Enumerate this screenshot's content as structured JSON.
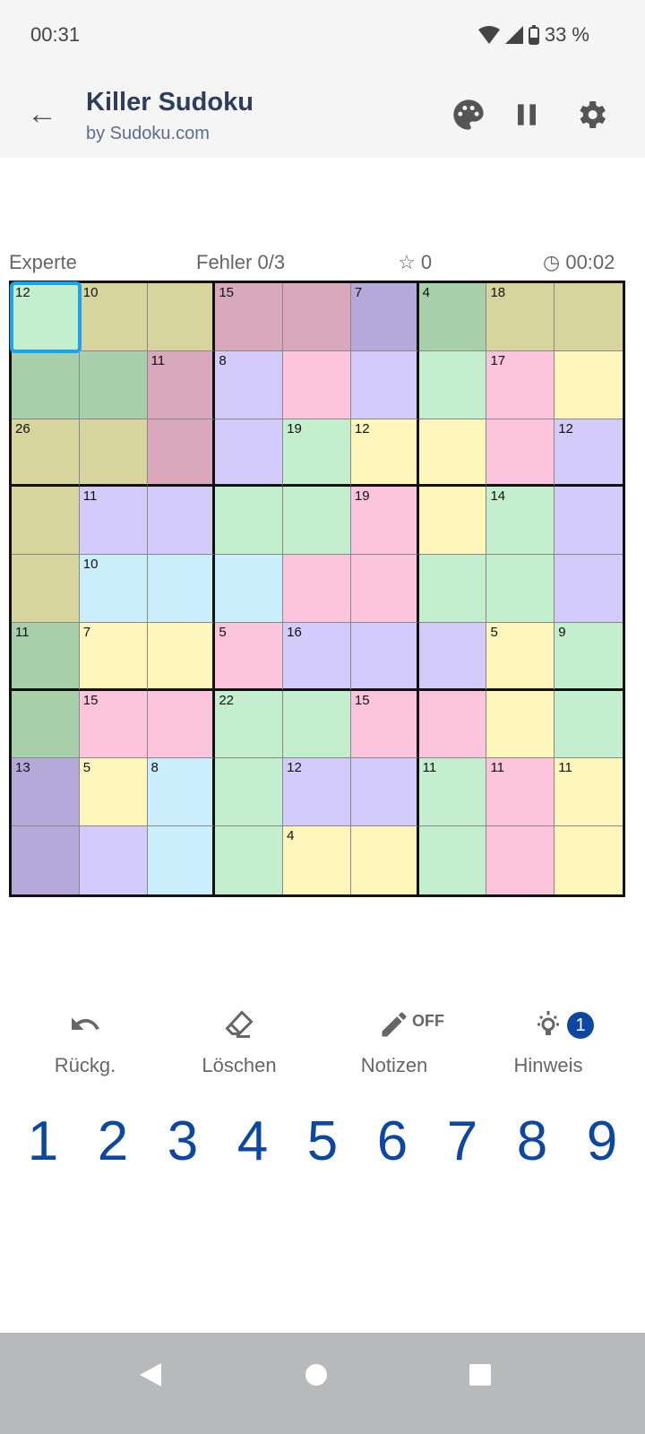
{
  "status_bar": {
    "time": "00:31",
    "battery": "33 %"
  },
  "app_bar": {
    "title": "Killer Sudoku",
    "subtitle": "by Sudoku.com"
  },
  "info": {
    "difficulty": "Experte",
    "mistakes": "Fehler 0/3",
    "score": "0",
    "timer": "00:02"
  },
  "colors": {
    "G": "#c3efcf",
    "O": "#d8d49e",
    "R": "#d9a9bb",
    "P": "#fcc5dc",
    "V": "#d3ccfa",
    "D": "#b5a9d9",
    "M": "#a6cfaa",
    "Y": "#fff6bb",
    "B": "#cbeefc",
    "accent": "#0d47a1",
    "selection": "#1aa3f0"
  },
  "grid": {
    "colors": [
      "GOORRDMOO",
      "MMRVPVGPY",
      "OORVGYYPV",
      "OVVGGPYGV",
      "OBBBPPGGV",
      "MYYPVVVYG",
      "MPPGGPPYG",
      "DYBGVVGPY",
      "DVBGYYGPY"
    ],
    "selected": [
      0,
      0
    ],
    "cage_sums": [
      [
        0,
        0,
        12
      ],
      [
        0,
        1,
        10
      ],
      [
        0,
        3,
        15
      ],
      [
        0,
        5,
        7
      ],
      [
        0,
        6,
        4
      ],
      [
        0,
        7,
        18
      ],
      [
        1,
        2,
        11
      ],
      [
        1,
        3,
        8
      ],
      [
        1,
        7,
        17
      ],
      [
        2,
        0,
        26
      ],
      [
        2,
        4,
        19
      ],
      [
        2,
        5,
        12
      ],
      [
        2,
        8,
        12
      ],
      [
        3,
        1,
        11
      ],
      [
        3,
        5,
        19
      ],
      [
        3,
        7,
        14
      ],
      [
        4,
        1,
        10
      ],
      [
        5,
        0,
        11
      ],
      [
        5,
        1,
        7
      ],
      [
        5,
        3,
        5
      ],
      [
        5,
        4,
        16
      ],
      [
        5,
        7,
        5
      ],
      [
        5,
        8,
        9
      ],
      [
        6,
        1,
        15
      ],
      [
        6,
        3,
        22
      ],
      [
        6,
        5,
        15
      ],
      [
        7,
        0,
        13
      ],
      [
        7,
        1,
        5
      ],
      [
        7,
        2,
        8
      ],
      [
        7,
        4,
        12
      ],
      [
        7,
        6,
        11
      ],
      [
        7,
        7,
        11
      ],
      [
        7,
        8,
        11
      ],
      [
        8,
        4,
        4
      ]
    ]
  },
  "tools": {
    "undo": "Rückg.",
    "erase": "Löschen",
    "notes": "Notizen",
    "notes_state": "OFF",
    "hint": "Hinweis",
    "hint_count": "1"
  },
  "numpad": [
    "1",
    "2",
    "3",
    "4",
    "5",
    "6",
    "7",
    "8",
    "9"
  ]
}
